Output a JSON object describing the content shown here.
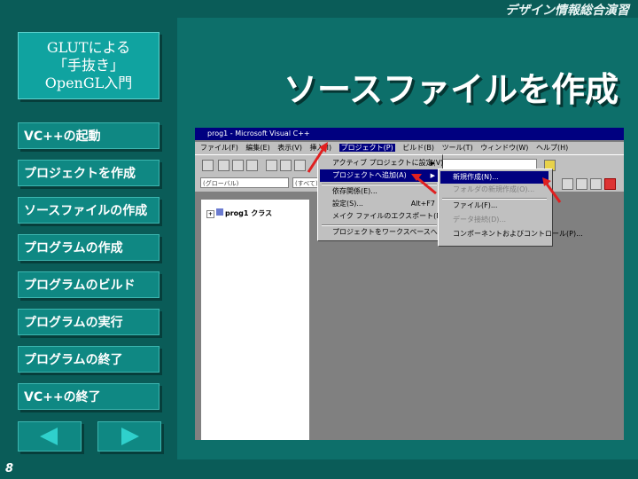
{
  "header": {
    "title": "デザイン情報総合演習"
  },
  "logo": {
    "line1": "GLUTによる",
    "line2": "「手抜き」",
    "line3": "OpenGL入門"
  },
  "page_title": "ソースファイルを作成",
  "nav": [
    {
      "label": "VC++の起動"
    },
    {
      "label": "プロジェクトを作成"
    },
    {
      "label": "ソースファイルの作成"
    },
    {
      "label": "プログラムの作成"
    },
    {
      "label": "プログラムのビルド"
    },
    {
      "label": "プログラムの実行"
    },
    {
      "label": "プログラムの終了"
    },
    {
      "label": "VC++の終了"
    }
  ],
  "page_number": "8",
  "screenshot": {
    "window_title": "prog1 - Microsoft Visual C++",
    "menus": [
      "ファイル(F)",
      "編集(E)",
      "表示(V)",
      "挿入(I)",
      "プロジェクト(P)",
      "ビルド(B)",
      "ツール(T)",
      "ウィンドウ(W)",
      "ヘルプ(H)"
    ],
    "combo1": "(グローバル)",
    "combo2": "(すべて)",
    "tree_root": "prog1 クラス",
    "project_menu": [
      {
        "label": "アクティブ プロジェクトに設定(V)",
        "shortcut": ""
      },
      {
        "label": "プロジェクトへ追加(A)",
        "shortcut": ""
      },
      {
        "label": "依存関係(E)...",
        "shortcut": ""
      },
      {
        "label": "設定(S)...",
        "shortcut": "Alt+F7"
      },
      {
        "label": "メイク ファイルのエクスポート(M)...",
        "shortcut": ""
      },
      {
        "label": "プロジェクトをワークスペースへ挿入(I)...",
        "shortcut": ""
      }
    ],
    "add_menu": [
      {
        "label": "新規作成(N)..."
      },
      {
        "label": "フォルダの新規作成(O)..."
      },
      {
        "label": "ファイル(F)..."
      },
      {
        "label": "データ接続(D)..."
      },
      {
        "label": "コンポーネントおよびコントロール(P)..."
      }
    ]
  }
}
